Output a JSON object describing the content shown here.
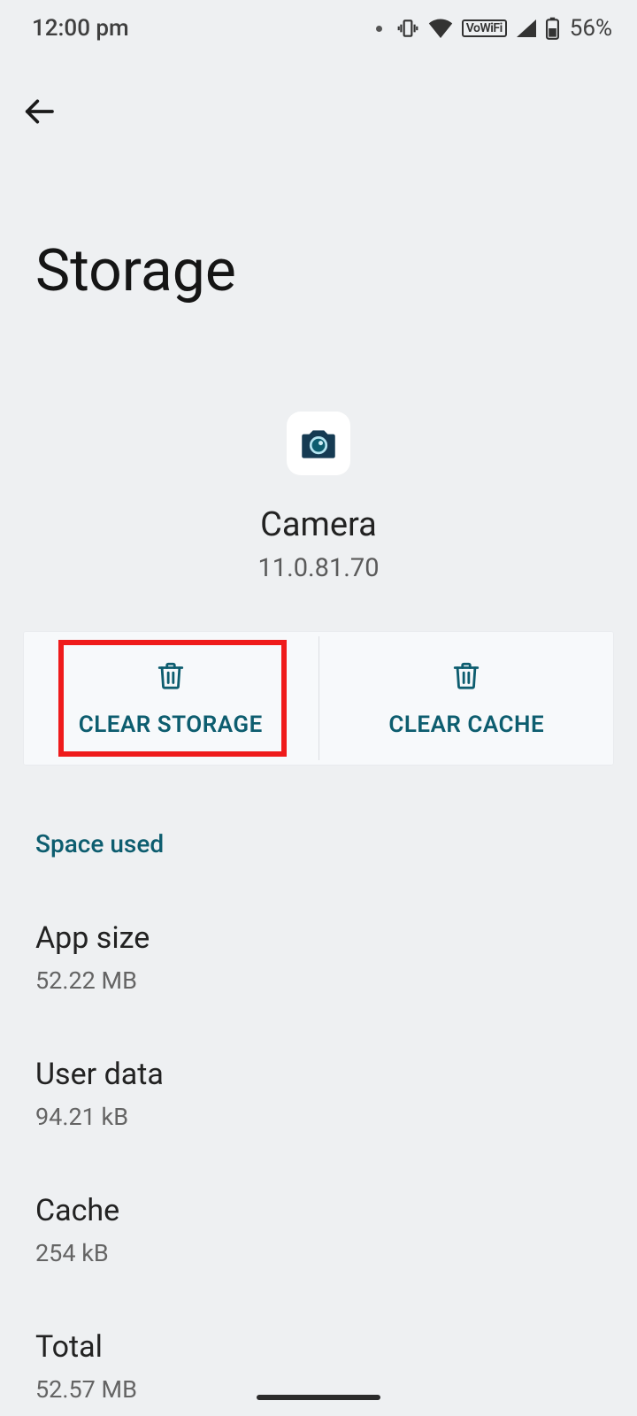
{
  "status": {
    "time": "12:00 pm",
    "battery_text": "56%"
  },
  "page": {
    "title": "Storage"
  },
  "app": {
    "name": "Camera",
    "version": "11.0.81.70"
  },
  "actions": {
    "clear_storage": "CLEAR STORAGE",
    "clear_cache": "CLEAR CACHE"
  },
  "section": {
    "space_used": "Space used"
  },
  "rows": {
    "app_size": {
      "label": "App size",
      "value": "52.22 MB"
    },
    "user_data": {
      "label": "User data",
      "value": "94.21 kB"
    },
    "cache": {
      "label": "Cache",
      "value": "254 kB"
    },
    "total": {
      "label": "Total",
      "value": "52.57 MB"
    }
  },
  "colors": {
    "teal": "#0d5d6f",
    "highlight_red": "#ef1b1b",
    "bg": "#eef0f2"
  }
}
